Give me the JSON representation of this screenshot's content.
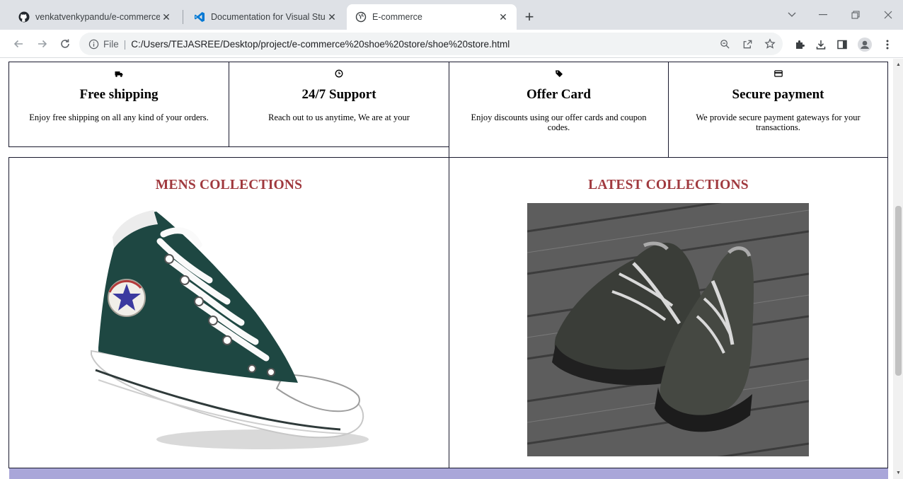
{
  "browser": {
    "tabs": [
      {
        "title": "venkatvenkypandu/e-commerce",
        "favicon": "github-icon"
      },
      {
        "title": "Documentation for Visual Studio",
        "favicon": "vscode-icon"
      },
      {
        "title": "E-commerce",
        "favicon": "globe-icon"
      }
    ],
    "address": {
      "scheme": "File",
      "url": "C:/Users/TEJASREE/Desktop/project/e-commerce%20shoe%20store/shoe%20store.html"
    },
    "accent": "#1a73e8"
  },
  "features": [
    {
      "icon": "truck-icon",
      "title": "Free shipping",
      "text": "Enjoy free shipping on all any kind of your orders."
    },
    {
      "icon": "clock-icon",
      "title": "24/7 Support",
      "text": "Reach out to us anytime, We are at your"
    },
    {
      "icon": "tag-icon",
      "title": "Offer Card",
      "text": "Enjoy discounts using our offer cards and coupon codes."
    },
    {
      "icon": "credit-card-icon",
      "title": "Secure payment",
      "text": "We provide secure payment gateways for your transactions."
    }
  ],
  "collections": [
    {
      "title": "MENS COLLECTIONS",
      "image": "green-high-top-sneaker"
    },
    {
      "title": "LATEST COLLECTIONS",
      "image": "dark-hiking-shoes-on-wood"
    }
  ],
  "colors": {
    "heading": "#a0393e",
    "border": "#1a1a2e",
    "footer_band": "#a9a6d9"
  }
}
